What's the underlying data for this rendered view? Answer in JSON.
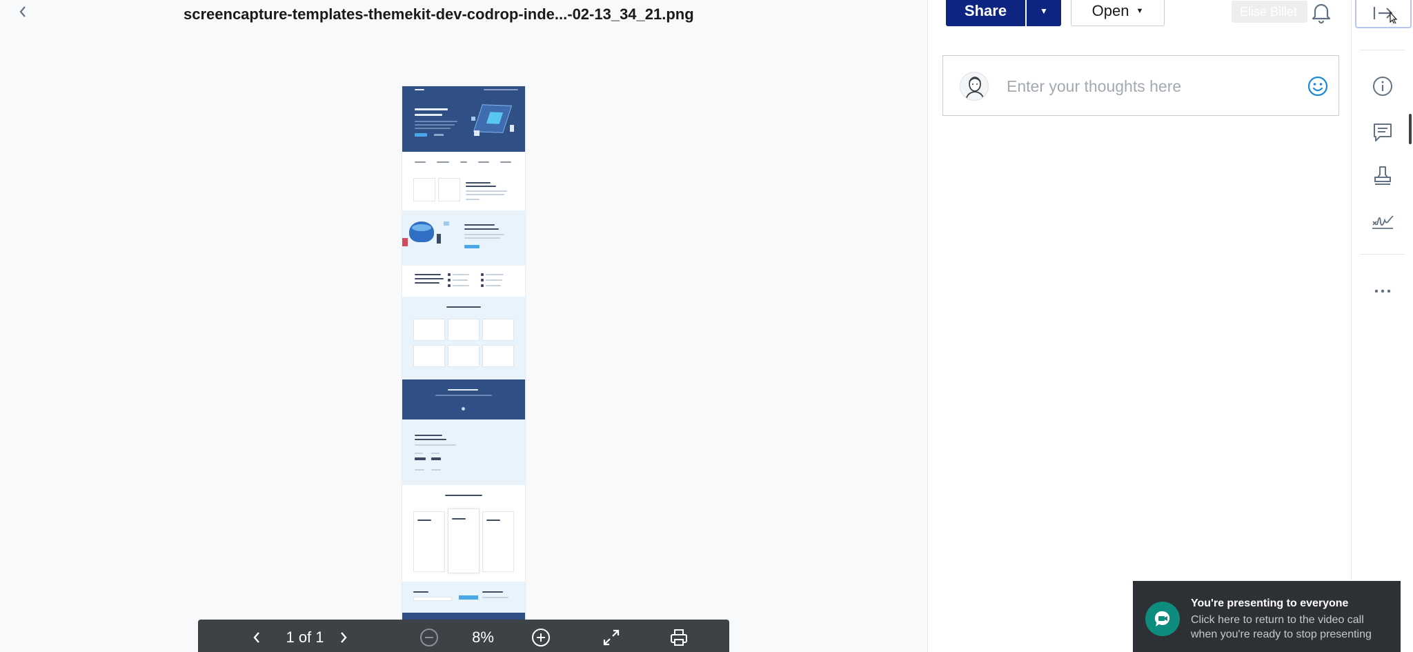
{
  "viewer": {
    "file_title": "screencapture-templates-themekit-dev-codrop-inde...-02-13_34_21.png",
    "back_icon": "chevron-left-icon"
  },
  "page_toolbar": {
    "page_indicator": "1 of 1",
    "zoom": "8%",
    "icons": [
      "chevron-left-icon",
      "chevron-right-icon",
      "zoom-out-icon",
      "zoom-in-icon",
      "fullscreen-icon",
      "print-icon"
    ]
  },
  "header": {
    "share_label": "Share",
    "open_label": "Open",
    "user_label": "Elise Billet"
  },
  "comments": {
    "placeholder": "Enter your thoughts here"
  },
  "rail": {
    "items": [
      "collapse-panel-icon",
      "info-icon",
      "comment-icon",
      "stamp-icon",
      "signature-icon",
      "more-icon"
    ]
  },
  "toast": {
    "title": "You're presenting to everyone",
    "body": "Click here to return to the video call when you're ready to stop presenting"
  },
  "colors": {
    "primary": "#0d2481",
    "doc_hero": "#2f4f85",
    "doc_light": "#e9f3fc",
    "toast_bg": "#2d3135",
    "toast_icon": "#0e8d7e",
    "emoji_blue": "#1a8ad8"
  }
}
